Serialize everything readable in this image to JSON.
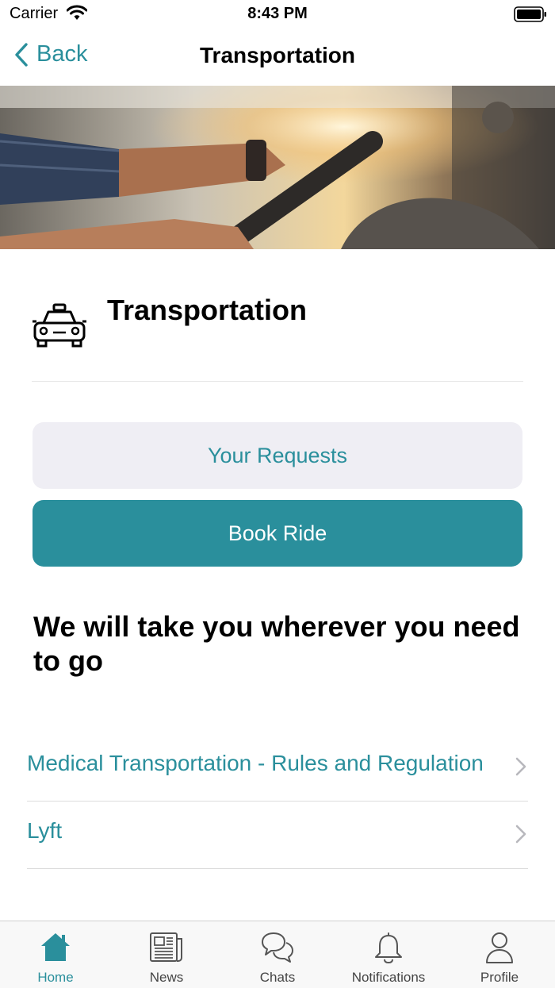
{
  "status_bar": {
    "carrier": "Carrier",
    "time": "8:43 PM"
  },
  "nav": {
    "back_label": "Back",
    "title": "Transportation"
  },
  "section": {
    "title": "Transportation",
    "icon": "taxi-icon"
  },
  "buttons": {
    "requests_label": "Your Requests",
    "book_label": "Book Ride"
  },
  "tagline": "We will take you wherever you need to go",
  "links": [
    {
      "label": "Medical Transportation - Rules and Regulation"
    },
    {
      "label": "Lyft"
    }
  ],
  "tabs": [
    {
      "label": "Home",
      "icon": "home-icon",
      "active": true
    },
    {
      "label": "News",
      "icon": "newspaper-icon",
      "active": false
    },
    {
      "label": "Chats",
      "icon": "chat-bubbles-icon",
      "active": false
    },
    {
      "label": "Notifications",
      "icon": "bell-icon",
      "active": false
    },
    {
      "label": "Profile",
      "icon": "person-icon",
      "active": false
    }
  ],
  "colors": {
    "accent": "#2a8f9c",
    "button_secondary_bg": "#efeef4"
  }
}
